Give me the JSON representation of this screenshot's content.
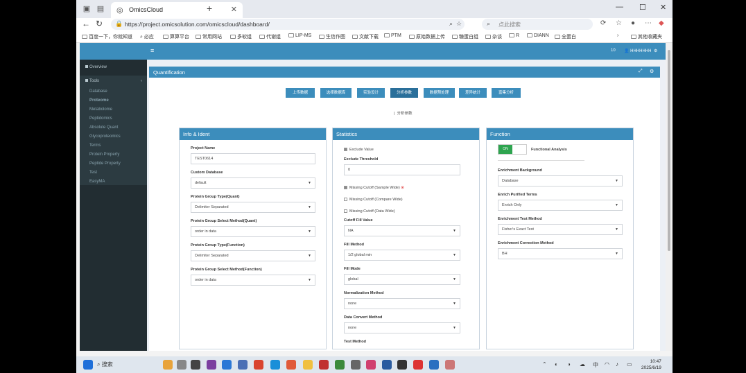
{
  "browser": {
    "tab_title": "OmicsCloud",
    "url": "https://project.omicsolution.com/omicscloud/dashboard/",
    "search_placeholder": "点此搜索",
    "bookmarks": [
      "百度一下，你就知道",
      "必应",
      "算算平台",
      "常用网站",
      "多软组",
      "代谢组",
      "LIP-MS",
      "生信作图",
      "文献下载",
      "PTM",
      "原始数据上传",
      "糖蛋白组",
      "杂谈",
      "R",
      "DIANN",
      "全蛋白"
    ],
    "other_bookmarks": "其他收藏夹"
  },
  "app": {
    "header_right_icon_count": "10",
    "user_label": "HHHHHHH"
  },
  "sidebar": {
    "overview": "Overview",
    "tools": "Tools",
    "items": [
      "Database",
      "Proteome",
      "Metabolome",
      "Peptidomics",
      "Absolute Quant",
      "Glycoproteomics",
      "Terms",
      "Protein Property",
      "Peptide Property",
      "Test",
      "EasyMA"
    ],
    "active_index": 1
  },
  "quant": {
    "title": "Quantification",
    "steps": [
      "上传数据",
      "选择数据库",
      "实验设计",
      "分析参数",
      "数据预处理",
      "差异统计",
      "富集分析"
    ],
    "current_step": 3,
    "step_label": "分析参数"
  },
  "info": {
    "title": "Info & Ident",
    "fields": [
      {
        "label": "Project Name",
        "value": "TEST0614",
        "type": "input"
      },
      {
        "label": "Custom Database",
        "value": "default",
        "type": "select"
      },
      {
        "label": "Protein Group Type(Quant)",
        "value": "Delimiter Separated",
        "type": "select"
      },
      {
        "label": "Protein Group Select Method(Quant)",
        "value": "order in data",
        "type": "select"
      },
      {
        "label": "Protein Group Type(Function)",
        "value": "Delimiter Separated",
        "type": "select"
      },
      {
        "label": "Protein Group Select Method(Function)",
        "value": "order in data",
        "type": "select"
      }
    ]
  },
  "stats": {
    "title": "Statistics",
    "exclude_value": "Exclude Value",
    "exclude_threshold_label": "Exclude Threshold",
    "exclude_threshold_value": "0",
    "missing_sample": "Missing Cutoff (Sample Wide)",
    "missing_compare": "Missing Cutoff (Compare Wide)",
    "missing_data": "Missing Cutoff (Data Wide)",
    "fields": [
      {
        "label": "Cutoff Fill Value",
        "value": "NA"
      },
      {
        "label": "Fill Method",
        "value": "1/2 global min"
      },
      {
        "label": "Fill Mode",
        "value": "global"
      },
      {
        "label": "Normalization Method",
        "value": "none"
      },
      {
        "label": "Data Convert Method",
        "value": "none"
      }
    ],
    "last_label": "Test Method"
  },
  "func": {
    "title": "Function",
    "toggle_on": "ON",
    "toggle_label": "Functional Analysis",
    "fields": [
      {
        "label": "Enrichment Background",
        "value": "Database"
      },
      {
        "label": "Enrich Purified Terms",
        "value": "Enrich Only"
      },
      {
        "label": "Enrichment Test Method",
        "value": "Fisher's Exact Test"
      },
      {
        "label": "Enrichment Correction Method",
        "value": "BH"
      }
    ]
  },
  "taskbar": {
    "search": "搜索",
    "ime": "中",
    "time": "10:47",
    "date": "2025/6/19"
  }
}
